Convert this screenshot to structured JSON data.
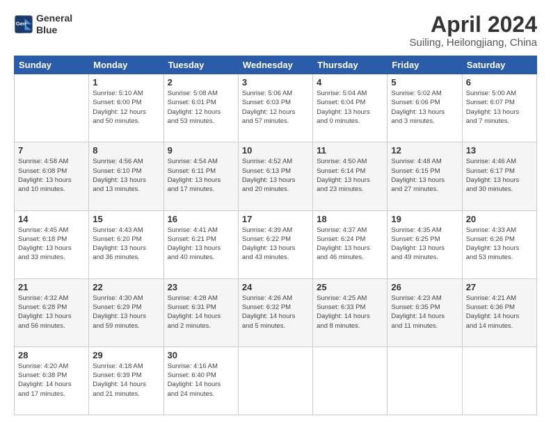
{
  "header": {
    "logo_line1": "General",
    "logo_line2": "Blue",
    "title": "April 2024",
    "subtitle": "Suiling, Heilongjiang, China"
  },
  "days_of_week": [
    "Sunday",
    "Monday",
    "Tuesday",
    "Wednesday",
    "Thursday",
    "Friday",
    "Saturday"
  ],
  "weeks": [
    [
      {
        "day": "",
        "info": ""
      },
      {
        "day": "1",
        "info": "Sunrise: 5:10 AM\nSunset: 6:00 PM\nDaylight: 12 hours\nand 50 minutes."
      },
      {
        "day": "2",
        "info": "Sunrise: 5:08 AM\nSunset: 6:01 PM\nDaylight: 12 hours\nand 53 minutes."
      },
      {
        "day": "3",
        "info": "Sunrise: 5:06 AM\nSunset: 6:03 PM\nDaylight: 12 hours\nand 57 minutes."
      },
      {
        "day": "4",
        "info": "Sunrise: 5:04 AM\nSunset: 6:04 PM\nDaylight: 13 hours\nand 0 minutes."
      },
      {
        "day": "5",
        "info": "Sunrise: 5:02 AM\nSunset: 6:06 PM\nDaylight: 13 hours\nand 3 minutes."
      },
      {
        "day": "6",
        "info": "Sunrise: 5:00 AM\nSunset: 6:07 PM\nDaylight: 13 hours\nand 7 minutes."
      }
    ],
    [
      {
        "day": "7",
        "info": "Sunrise: 4:58 AM\nSunset: 6:08 PM\nDaylight: 13 hours\nand 10 minutes."
      },
      {
        "day": "8",
        "info": "Sunrise: 4:56 AM\nSunset: 6:10 PM\nDaylight: 13 hours\nand 13 minutes."
      },
      {
        "day": "9",
        "info": "Sunrise: 4:54 AM\nSunset: 6:11 PM\nDaylight: 13 hours\nand 17 minutes."
      },
      {
        "day": "10",
        "info": "Sunrise: 4:52 AM\nSunset: 6:13 PM\nDaylight: 13 hours\nand 20 minutes."
      },
      {
        "day": "11",
        "info": "Sunrise: 4:50 AM\nSunset: 6:14 PM\nDaylight: 13 hours\nand 23 minutes."
      },
      {
        "day": "12",
        "info": "Sunrise: 4:48 AM\nSunset: 6:15 PM\nDaylight: 13 hours\nand 27 minutes."
      },
      {
        "day": "13",
        "info": "Sunrise: 4:46 AM\nSunset: 6:17 PM\nDaylight: 13 hours\nand 30 minutes."
      }
    ],
    [
      {
        "day": "14",
        "info": "Sunrise: 4:45 AM\nSunset: 6:18 PM\nDaylight: 13 hours\nand 33 minutes."
      },
      {
        "day": "15",
        "info": "Sunrise: 4:43 AM\nSunset: 6:20 PM\nDaylight: 13 hours\nand 36 minutes."
      },
      {
        "day": "16",
        "info": "Sunrise: 4:41 AM\nSunset: 6:21 PM\nDaylight: 13 hours\nand 40 minutes."
      },
      {
        "day": "17",
        "info": "Sunrise: 4:39 AM\nSunset: 6:22 PM\nDaylight: 13 hours\nand 43 minutes."
      },
      {
        "day": "18",
        "info": "Sunrise: 4:37 AM\nSunset: 6:24 PM\nDaylight: 13 hours\nand 46 minutes."
      },
      {
        "day": "19",
        "info": "Sunrise: 4:35 AM\nSunset: 6:25 PM\nDaylight: 13 hours\nand 49 minutes."
      },
      {
        "day": "20",
        "info": "Sunrise: 4:33 AM\nSunset: 6:26 PM\nDaylight: 13 hours\nand 53 minutes."
      }
    ],
    [
      {
        "day": "21",
        "info": "Sunrise: 4:32 AM\nSunset: 6:28 PM\nDaylight: 13 hours\nand 56 minutes."
      },
      {
        "day": "22",
        "info": "Sunrise: 4:30 AM\nSunset: 6:29 PM\nDaylight: 13 hours\nand 59 minutes."
      },
      {
        "day": "23",
        "info": "Sunrise: 4:28 AM\nSunset: 6:31 PM\nDaylight: 14 hours\nand 2 minutes."
      },
      {
        "day": "24",
        "info": "Sunrise: 4:26 AM\nSunset: 6:32 PM\nDaylight: 14 hours\nand 5 minutes."
      },
      {
        "day": "25",
        "info": "Sunrise: 4:25 AM\nSunset: 6:33 PM\nDaylight: 14 hours\nand 8 minutes."
      },
      {
        "day": "26",
        "info": "Sunrise: 4:23 AM\nSunset: 6:35 PM\nDaylight: 14 hours\nand 11 minutes."
      },
      {
        "day": "27",
        "info": "Sunrise: 4:21 AM\nSunset: 6:36 PM\nDaylight: 14 hours\nand 14 minutes."
      }
    ],
    [
      {
        "day": "28",
        "info": "Sunrise: 4:20 AM\nSunset: 6:38 PM\nDaylight: 14 hours\nand 17 minutes."
      },
      {
        "day": "29",
        "info": "Sunrise: 4:18 AM\nSunset: 6:39 PM\nDaylight: 14 hours\nand 21 minutes."
      },
      {
        "day": "30",
        "info": "Sunrise: 4:16 AM\nSunset: 6:40 PM\nDaylight: 14 hours\nand 24 minutes."
      },
      {
        "day": "",
        "info": ""
      },
      {
        "day": "",
        "info": ""
      },
      {
        "day": "",
        "info": ""
      },
      {
        "day": "",
        "info": ""
      }
    ]
  ]
}
